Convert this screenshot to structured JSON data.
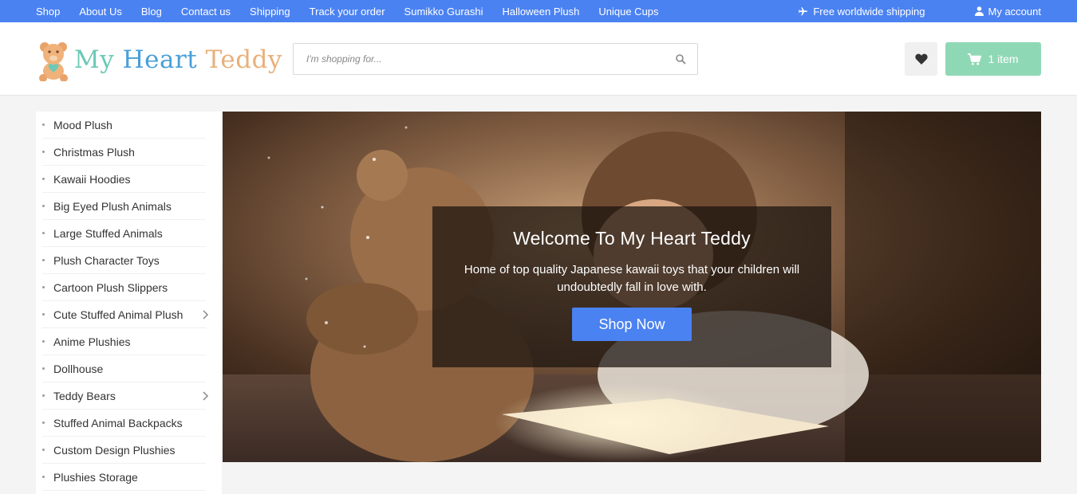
{
  "topbar": {
    "links": [
      "Shop",
      "About Us",
      "Blog",
      "Contact us",
      "Shipping",
      "Track your order",
      "Sumikko Gurashi",
      "Halloween Plush",
      "Unique Cups"
    ],
    "shipping_label": "Free worldwide shipping",
    "account_label": "My account"
  },
  "header": {
    "logo": {
      "word1": "My",
      "word2": "Heart",
      "word3": "Teddy"
    },
    "search": {
      "placeholder": "I'm shopping for..."
    },
    "cart_label": "1 item"
  },
  "sidebar": {
    "items": [
      {
        "label": "Mood Plush",
        "has_submenu": false
      },
      {
        "label": "Christmas Plush",
        "has_submenu": false
      },
      {
        "label": "Kawaii Hoodies",
        "has_submenu": false
      },
      {
        "label": "Big Eyed Plush Animals",
        "has_submenu": false
      },
      {
        "label": "Large Stuffed Animals",
        "has_submenu": false
      },
      {
        "label": "Plush Character Toys",
        "has_submenu": false
      },
      {
        "label": "Cartoon Plush Slippers",
        "has_submenu": false
      },
      {
        "label": "Cute Stuffed Animal Plush",
        "has_submenu": true
      },
      {
        "label": "Anime Plushies",
        "has_submenu": false
      },
      {
        "label": "Dollhouse",
        "has_submenu": false
      },
      {
        "label": "Teddy Bears",
        "has_submenu": true
      },
      {
        "label": "Stuffed Animal Backpacks",
        "has_submenu": false
      },
      {
        "label": "Custom Design Plushies",
        "has_submenu": false
      },
      {
        "label": "Plushies Storage",
        "has_submenu": false
      }
    ]
  },
  "hero": {
    "title": "Welcome To My Heart Teddy",
    "subtitle": "Home of top quality Japanese kawaii toys that your children will undoubtedly fall in love with.",
    "button_label": "Shop Now"
  },
  "colors": {
    "topbar": "#4b82f2",
    "cart_button": "#8fd8b6",
    "cta_button": "#4b82f2"
  },
  "icons": {
    "shipping": "airplane-icon",
    "account": "user-icon",
    "search": "search-icon",
    "wishlist": "heart-icon",
    "cart": "cart-icon"
  }
}
